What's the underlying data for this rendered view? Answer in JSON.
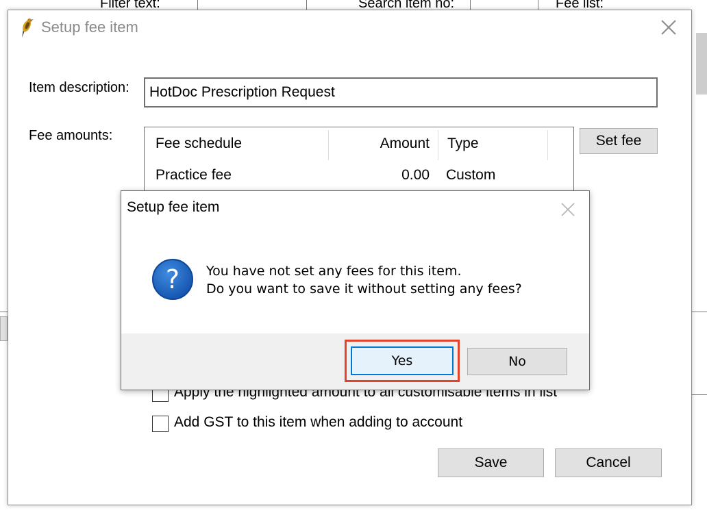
{
  "background": {
    "filter_label": "Filter text:",
    "search_label": "Search item no:",
    "fee_list_label": "Fee list:"
  },
  "main_dialog": {
    "title": "Setup fee item",
    "item_description_label": "Item description:",
    "item_description_value": "HotDoc Prescription Request",
    "fee_amounts_label": "Fee amounts:",
    "fee_table": {
      "columns": [
        "Fee schedule",
        "Amount",
        "Type"
      ],
      "rows": [
        {
          "schedule": "Practice fee",
          "amount": "0.00",
          "type": "Custom"
        }
      ]
    },
    "set_fee_label": "Set fee",
    "apply_highlighted_label": "Apply the highlighted amount to all customisable items in list",
    "add_gst_label": "Add GST to this item when adding to account",
    "save_label": "Save",
    "cancel_label": "Cancel"
  },
  "confirm_dialog": {
    "title": "Setup fee item",
    "message_line1": "You have not set any fees for this item.",
    "message_line2": "Do you want to save it without setting any fees?",
    "yes_label": "Yes",
    "no_label": "No",
    "icon": "question-icon"
  },
  "colors": {
    "highlight": "#e0452c",
    "focus_border": "#0078d7",
    "question_blue": "#1e6ac9",
    "button_face": "#e1e1e1"
  }
}
